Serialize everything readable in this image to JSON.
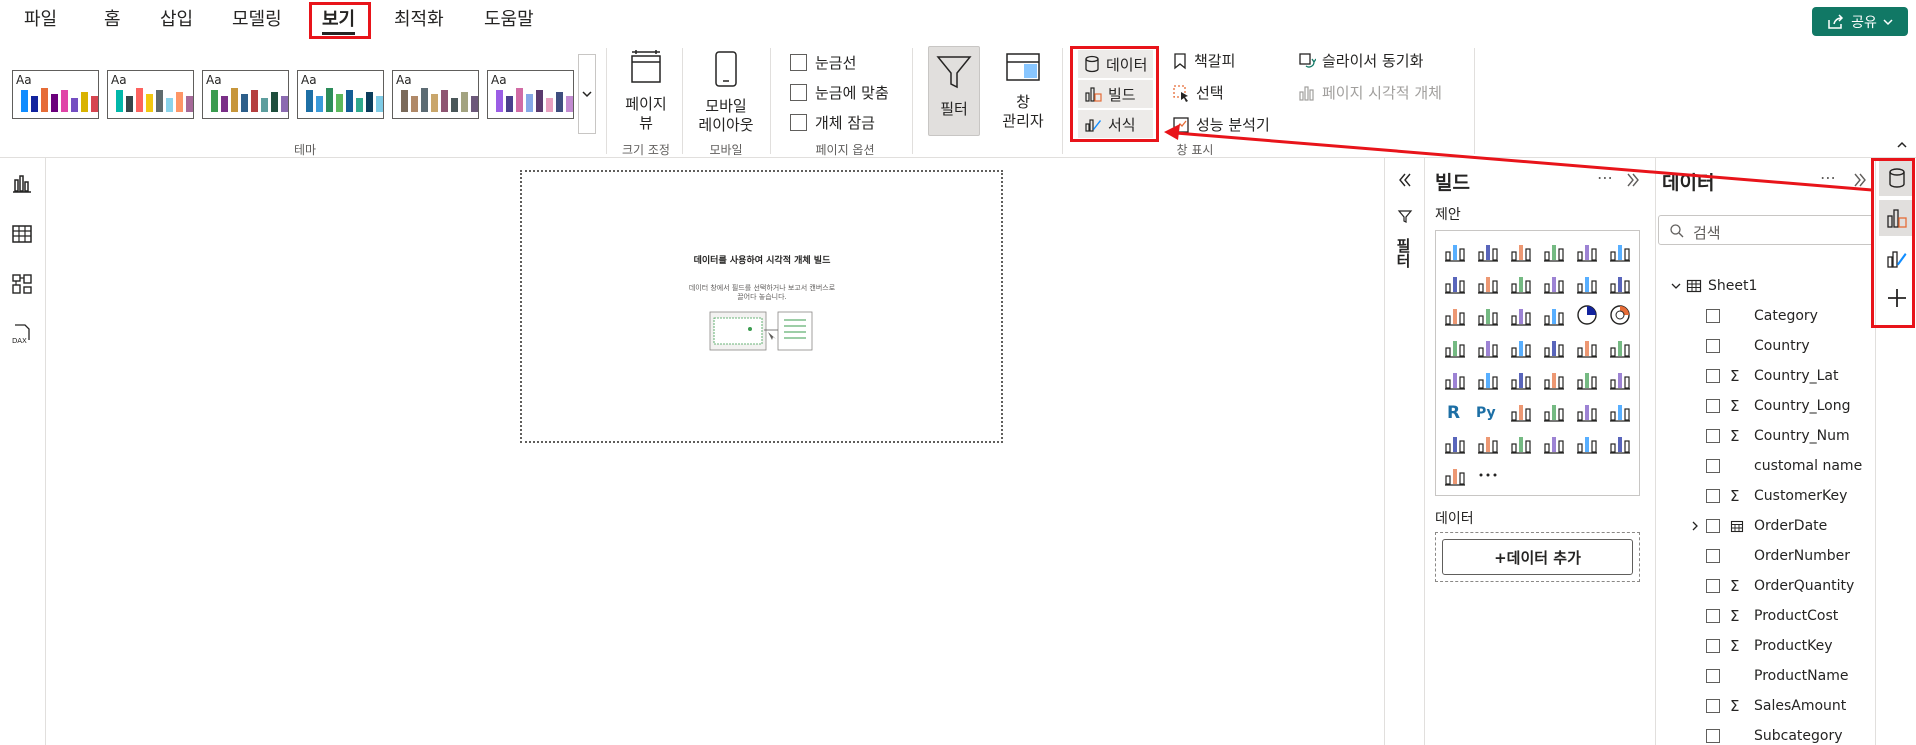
{
  "menu": {
    "file": "파일",
    "home": "홈",
    "insert": "삽입",
    "modeling": "모델링",
    "view": "보기",
    "optimize": "최적화",
    "help": "도움말"
  },
  "share_label": "공유",
  "ribbon": {
    "themes_label": "테마",
    "theme_aa": "Aa",
    "page_view_label": "페이지\n뷰",
    "size_group_label": "크기 조정",
    "mobile_layout_label": "모바일\n레이아웃",
    "mobile_group_label": "모바일",
    "gridlines_label": "눈금선",
    "snap_label": "눈금에 맞춤",
    "lock_label": "개체 잠금",
    "page_options_label": "페이지 옵션",
    "filter_label": "필터",
    "window_manager_label": "창\n관리자",
    "data_label": "데이터",
    "build_label": "빌드",
    "format_label": "서식",
    "bookmark_label": "책갈피",
    "selection_label": "선택",
    "performance_label": "성능 분석기",
    "slicer_sync_label": "슬라이서 동기화",
    "page_visual_label": "페이지 시각적 개체",
    "show_panes_label": "창 표시"
  },
  "canvas": {
    "placeholder_title": "데이터를 사용하여 시각적 개체 빌드",
    "placeholder_sub": "데이터 창에서 필드를 선택하거나 보고서 캔버스로 끌어다 놓습니다."
  },
  "filter_strip_label": "필터",
  "build_pane": {
    "title": "빌드",
    "suggest_label": "제안",
    "data_section": "데이터",
    "add_data_btn": "+데이터 추가",
    "more": "⋯"
  },
  "data_pane": {
    "title": "데이터",
    "search_placeholder": "검색",
    "table_name": "Sheet1",
    "fields": [
      {
        "name": "Category",
        "sigma": false,
        "calendar": false
      },
      {
        "name": "Country",
        "sigma": false,
        "calendar": false
      },
      {
        "name": "Country_Lat",
        "sigma": true,
        "calendar": false
      },
      {
        "name": "Country_Long",
        "sigma": true,
        "calendar": false
      },
      {
        "name": "Country_Num",
        "sigma": true,
        "calendar": false
      },
      {
        "name": "customal name",
        "sigma": false,
        "calendar": false
      },
      {
        "name": "CustomerKey",
        "sigma": true,
        "calendar": false
      },
      {
        "name": "OrderDate",
        "sigma": false,
        "calendar": true
      },
      {
        "name": "OrderNumber",
        "sigma": false,
        "calendar": false
      },
      {
        "name": "OrderQuantity",
        "sigma": true,
        "calendar": false
      },
      {
        "name": "ProductCost",
        "sigma": true,
        "calendar": false
      },
      {
        "name": "ProductKey",
        "sigma": true,
        "calendar": false
      },
      {
        "name": "ProductName",
        "sigma": false,
        "calendar": false
      },
      {
        "name": "SalesAmount",
        "sigma": true,
        "calendar": false
      },
      {
        "name": "Subcategory",
        "sigma": false,
        "calendar": false
      }
    ]
  },
  "colors": {
    "accent": "#117865",
    "highlight": "#e8141a"
  }
}
